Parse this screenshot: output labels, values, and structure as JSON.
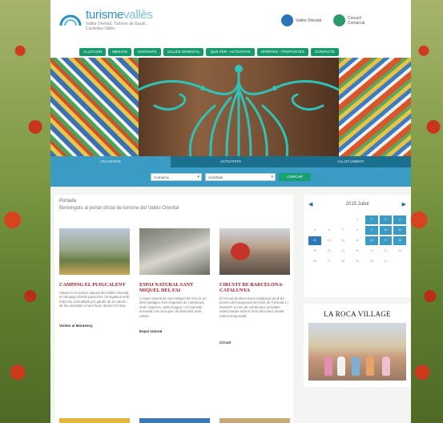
{
  "site": {
    "logo_main": "turisme",
    "logo_accent": "vallès",
    "logo_sub": "Vallès Oriental, Turisme de Gaudí, Cardedeu Vallès"
  },
  "sponsors": [
    {
      "label": "Vallès Oriental",
      "color": "#2b74b8"
    },
    {
      "label": "Consell Comarcal",
      "color": "#2d9a6a"
    }
  ],
  "nav": {
    "items": [
      "ALLOTJAR",
      "MENJAR",
      "VISITANTS",
      "VALLÈS ORIENTAL",
      "QUÈ FER - ACTIVITATS",
      "OFERTES - PROPOSTES",
      "CONTACTE"
    ]
  },
  "tabs": {
    "items": [
      "ON VISITAR",
      "ACTIVITATS",
      "ALLOTJAMENT"
    ],
    "active_index": 0
  },
  "search": {
    "select1": "Comarca",
    "select2": "Activitats",
    "button": "CERCAR"
  },
  "main": {
    "title": "Portada",
    "subtitle": "Benvinguts al portal oficial de turisme del Vallès Oriental"
  },
  "cards": [
    {
      "title": "CAMPING EL PUIGCALENT",
      "text": "Situat en un entorn natural del Vallès Oriental, el càmping ofereix parcel·les i bungalous amb totes les comoditats per gaudir de la natura i de les activitats a l'aire lliure durant tot l'any.",
      "foot": "Visites al Montseny"
    },
    {
      "title": "ESPAI NATURAL SANT MIQUEL DEL FAI",
      "text": "L'espai natural de Sant Miquel del Fai és un dels paratges més singulars de Catalunya, amb cingleres, salts d'aigua i un monestir encastat a la roca que cal descobrir amb calma.",
      "foot": "Espai natural"
    },
    {
      "title": "CIRCUIT DE BARCELONA-CATALUNYA",
      "text": "El Circuit de Barcelona-Catalunya acull les proves del campionat del món de Fórmula 1 i MotoGP, a més de nombroses activitats relacionades amb el món del motor durant tota la temporada.",
      "foot": "Circuit"
    }
  ],
  "calendar": {
    "month": "2015 Juliol",
    "days": [
      "",
      "",
      "",
      "1",
      "2",
      "3",
      "4",
      "5",
      "6",
      "7",
      "8",
      "9",
      "10",
      "11",
      "12",
      "13",
      "14",
      "15",
      "16",
      "17",
      "18",
      "19",
      "20",
      "21",
      "22",
      "23",
      "24",
      "25",
      "26",
      "27",
      "28",
      "29",
      "30",
      "31",
      "",
      ""
    ],
    "today_index": 14
  },
  "ad": {
    "logo": "LA ROCA VILLAGE"
  }
}
